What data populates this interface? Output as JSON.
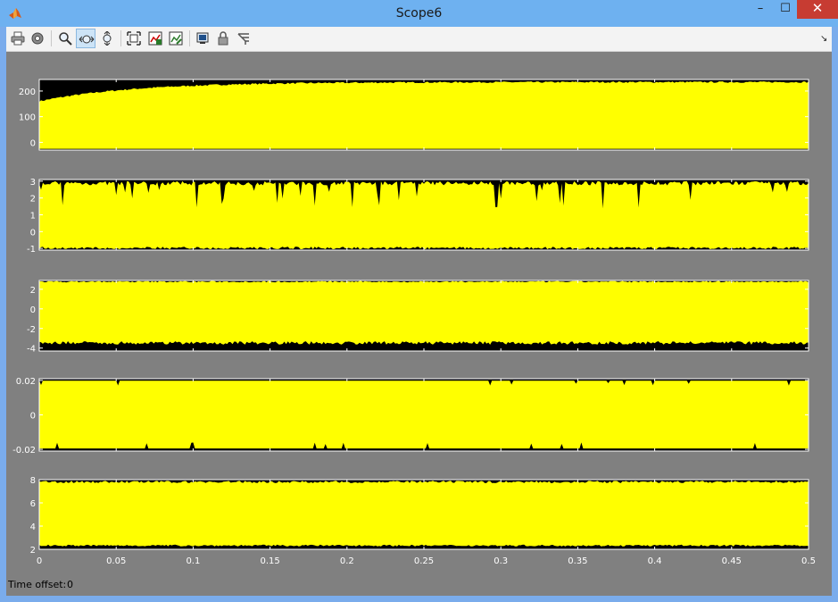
{
  "window": {
    "title": "Scope6"
  },
  "window_controls": {
    "minimize": "–",
    "maximize": "☐",
    "close": "✕"
  },
  "toolbar": {
    "buttons": [
      {
        "name": "print-button",
        "icon": "printer-icon"
      },
      {
        "name": "parameters-button",
        "icon": "gear-icon"
      },
      {
        "name": "zoom-button",
        "icon": "magnifier-icon"
      },
      {
        "name": "zoom-x-axis-button",
        "icon": "zoom-x-icon",
        "active": true
      },
      {
        "name": "zoom-y-axis-button",
        "icon": "zoom-y-icon"
      },
      {
        "name": "autoscale-button",
        "icon": "autoscale-icon"
      },
      {
        "name": "save-axes-settings-button",
        "icon": "save-axes-icon"
      },
      {
        "name": "restore-axes-settings-button",
        "icon": "restore-axes-icon"
      },
      {
        "name": "floating-scope-button",
        "icon": "floating-scope-icon"
      },
      {
        "name": "lock-axes-button",
        "icon": "lock-icon"
      },
      {
        "name": "signal-selection-button",
        "icon": "signal-selection-icon"
      }
    ]
  },
  "colors": {
    "figure_bg": "#808080",
    "axes_bg": "#000000",
    "trace": "#ffff00",
    "axis_text": "#ffffff"
  },
  "chart_data": [
    {
      "type": "area",
      "ytick_labels": [
        "0",
        "100",
        "200"
      ],
      "ylim": [
        -30,
        245
      ],
      "upper": "rises from about 160 at t=0 to about 235, hugging the top",
      "lower": "about -25"
    },
    {
      "type": "area",
      "ytick_labels": [
        "-1",
        "0",
        "1",
        "2",
        "3"
      ],
      "ylim": [
        -1.1,
        3.1
      ],
      "upper": "2.4 to 3 with dense drops",
      "lower": "about -1"
    },
    {
      "type": "area",
      "ytick_labels": [
        "-4",
        "-2",
        "0",
        "2"
      ],
      "ylim": [
        -4.3,
        2.9
      ],
      "upper": "about 2.8",
      "lower": "about -3.6"
    },
    {
      "type": "area",
      "ytick_labels": [
        "-0.02",
        "0",
        "0.02"
      ],
      "ylim": [
        -0.021,
        0.021
      ],
      "upper": "about 0.02",
      "lower": "about -0.02"
    },
    {
      "type": "area",
      "ytick_labels": [
        "2",
        "4",
        "6",
        "8"
      ],
      "ylim": [
        2,
        8
      ],
      "upper": "about 7.9",
      "lower": "about 2.3"
    }
  ],
  "x_axis": {
    "xlim": [
      0,
      0.5
    ],
    "ticks": [
      0,
      0.05,
      0.1,
      0.15,
      0.2,
      0.25,
      0.3,
      0.35,
      0.4,
      0.45,
      0.5
    ],
    "tick_labels": [
      "0",
      "0.05",
      "0.1",
      "0.15",
      "0.2",
      "0.25",
      "0.3",
      "0.35",
      "0.4",
      "0.45",
      "0.5"
    ]
  },
  "status": {
    "time_offset_label": "Time offset:",
    "time_offset_value": "0"
  }
}
